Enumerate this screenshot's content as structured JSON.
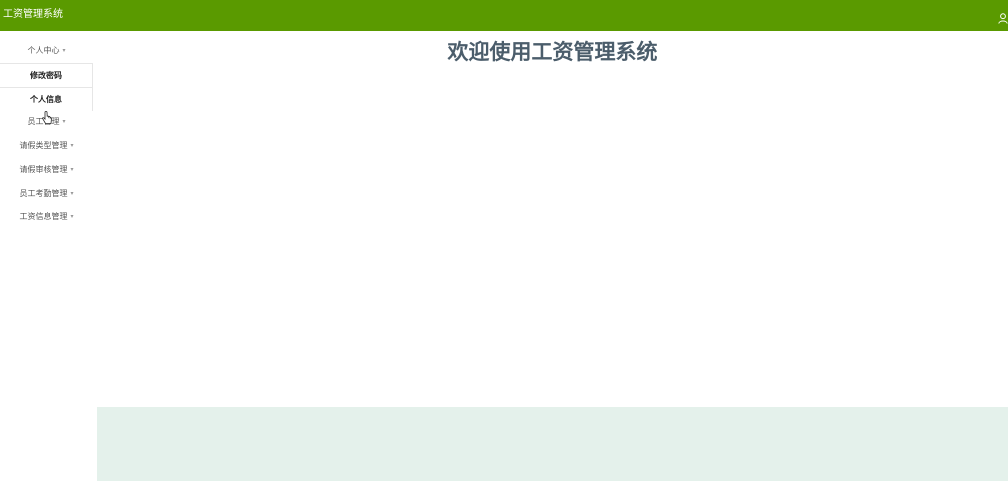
{
  "header": {
    "app_title": "工资管理系统",
    "user_icon": "user-icon",
    "bg_color": "#5a9a00"
  },
  "sidebar": {
    "items": [
      {
        "label": "个人中心",
        "caret": "▾"
      },
      {
        "label": "员工管理",
        "caret": "▾"
      },
      {
        "label": "请假类型管理",
        "caret": "▾"
      },
      {
        "label": "请假审核管理",
        "caret": "▾"
      },
      {
        "label": "员工考勤管理",
        "caret": "▾"
      },
      {
        "label": "工资信息管理",
        "caret": "▾"
      }
    ],
    "subitems": [
      {
        "label": "修改密码"
      },
      {
        "label": "个人信息"
      }
    ]
  },
  "main": {
    "welcome": "欢迎使用工资管理系统",
    "title_color": "#4b5d6b",
    "footer_color": "#e4f1eb"
  }
}
